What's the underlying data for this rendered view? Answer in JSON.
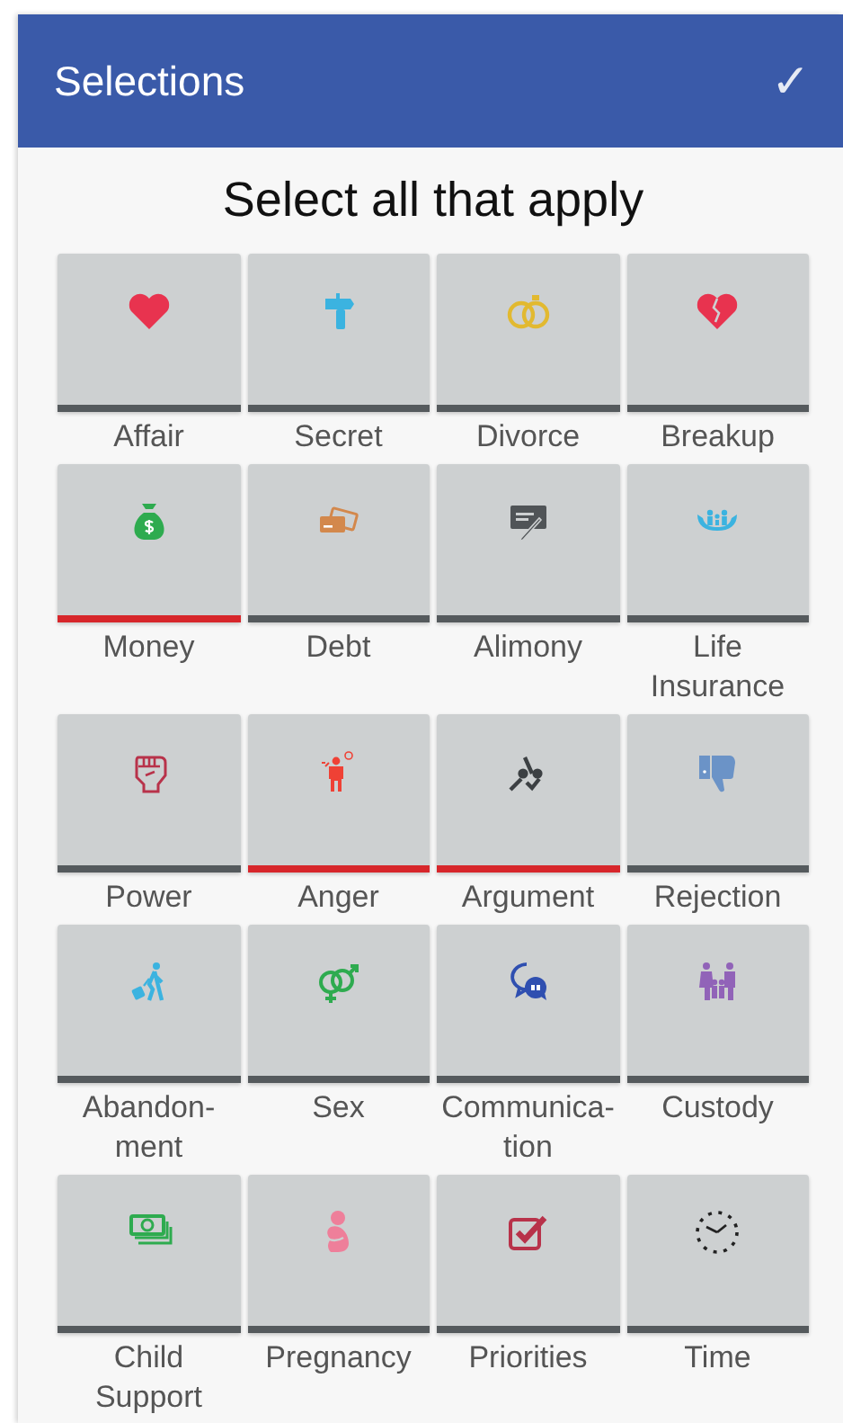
{
  "app_bar": {
    "title": "Selections",
    "confirm": "✓"
  },
  "heading": "Select all that apply",
  "options": [
    {
      "label": "Affair",
      "selected": false
    },
    {
      "label": "Secret",
      "selected": false
    },
    {
      "label": "Divorce",
      "selected": false
    },
    {
      "label": "Breakup",
      "selected": false
    },
    {
      "label": "Money",
      "selected": true
    },
    {
      "label": "Debt",
      "selected": false
    },
    {
      "label": "Alimony",
      "selected": false
    },
    {
      "label": "Life\nInsurance",
      "selected": false
    },
    {
      "label": "Power",
      "selected": false
    },
    {
      "label": "Anger",
      "selected": true
    },
    {
      "label": "Argument",
      "selected": true
    },
    {
      "label": "Rejection",
      "selected": false
    },
    {
      "label": "Abandon-\nment",
      "selected": false
    },
    {
      "label": "Sex",
      "selected": false
    },
    {
      "label": "Communica-\ntion",
      "selected": false
    },
    {
      "label": "Custody",
      "selected": false
    },
    {
      "label": "Child\nSupport",
      "selected": false
    },
    {
      "label": "Pregnancy",
      "selected": false
    },
    {
      "label": "Priorities",
      "selected": false
    },
    {
      "label": "Time",
      "selected": false
    }
  ]
}
